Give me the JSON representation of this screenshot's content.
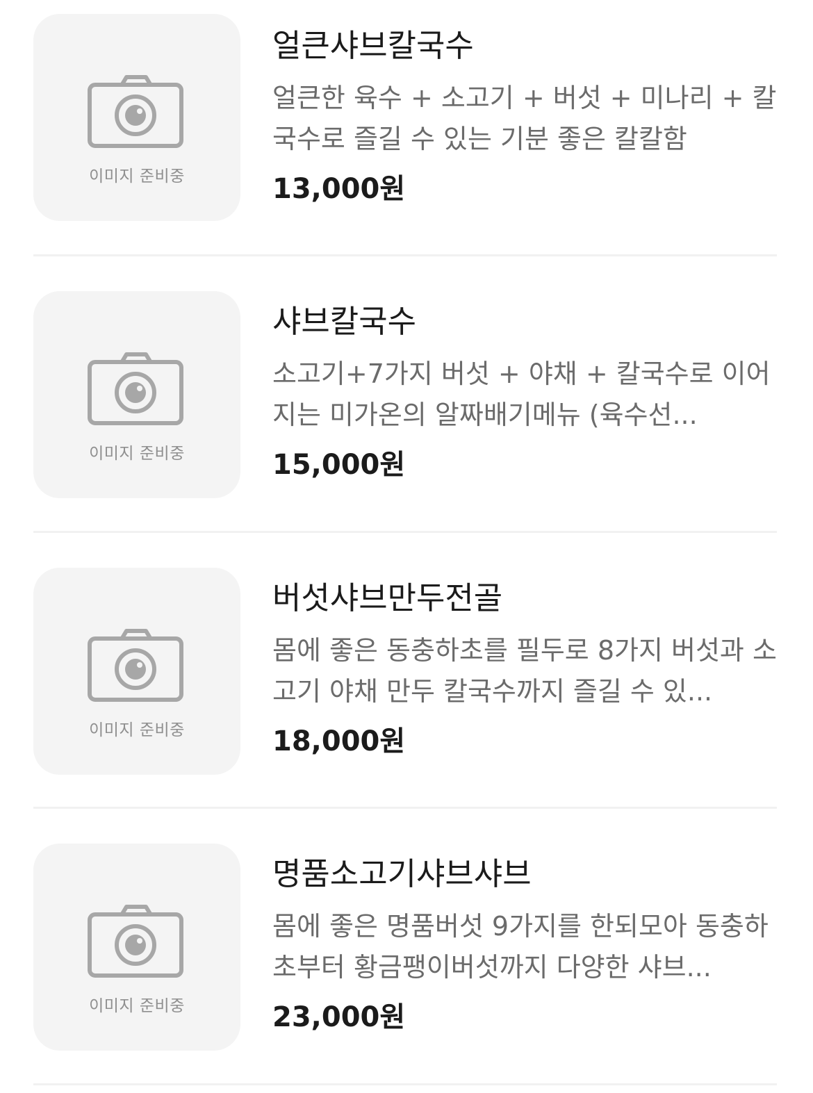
{
  "menu": {
    "items": [
      {
        "name": "얼큰샤브칼국수",
        "description": "얼큰한 육수 + 소고기 + 버섯 + 미나리 + 칼국수로 즐길 수 있는 기분 좋은 칼칼함",
        "price": "13,000원",
        "image_placeholder": "이미지 준비중",
        "image_icon": "camera-icon"
      },
      {
        "name": "샤브칼국수",
        "description": "소고기+7가지 버섯 + 야채 + 칼국수로 이어지는 미가온의 알짜배기메뉴 (육수선...",
        "price": "15,000원",
        "image_placeholder": "이미지 준비중",
        "image_icon": "camera-icon"
      },
      {
        "name": "버섯샤브만두전골",
        "description": "몸에 좋은 동충하초를 필두로 8가지 버섯과 소고기 야채 만두 칼국수까지 즐길 수 있...",
        "price": "18,000원",
        "image_placeholder": "이미지 준비중",
        "image_icon": "camera-icon"
      },
      {
        "name": "명품소고기샤브샤브",
        "description": "몸에 좋은 명품버섯 9가지를 한되모아 동충하초부터 황금팽이버섯까지 다양한 샤브...",
        "price": "23,000원",
        "image_placeholder": "이미지 준비중",
        "image_icon": "camera-icon"
      }
    ]
  },
  "colors": {
    "placeholder_bg": "#f4f4f4",
    "icon_gray": "#a7a7a7",
    "name_text": "#1b1b1b",
    "desc_text": "#6b6b6b",
    "divider": "#f1f1f1"
  }
}
